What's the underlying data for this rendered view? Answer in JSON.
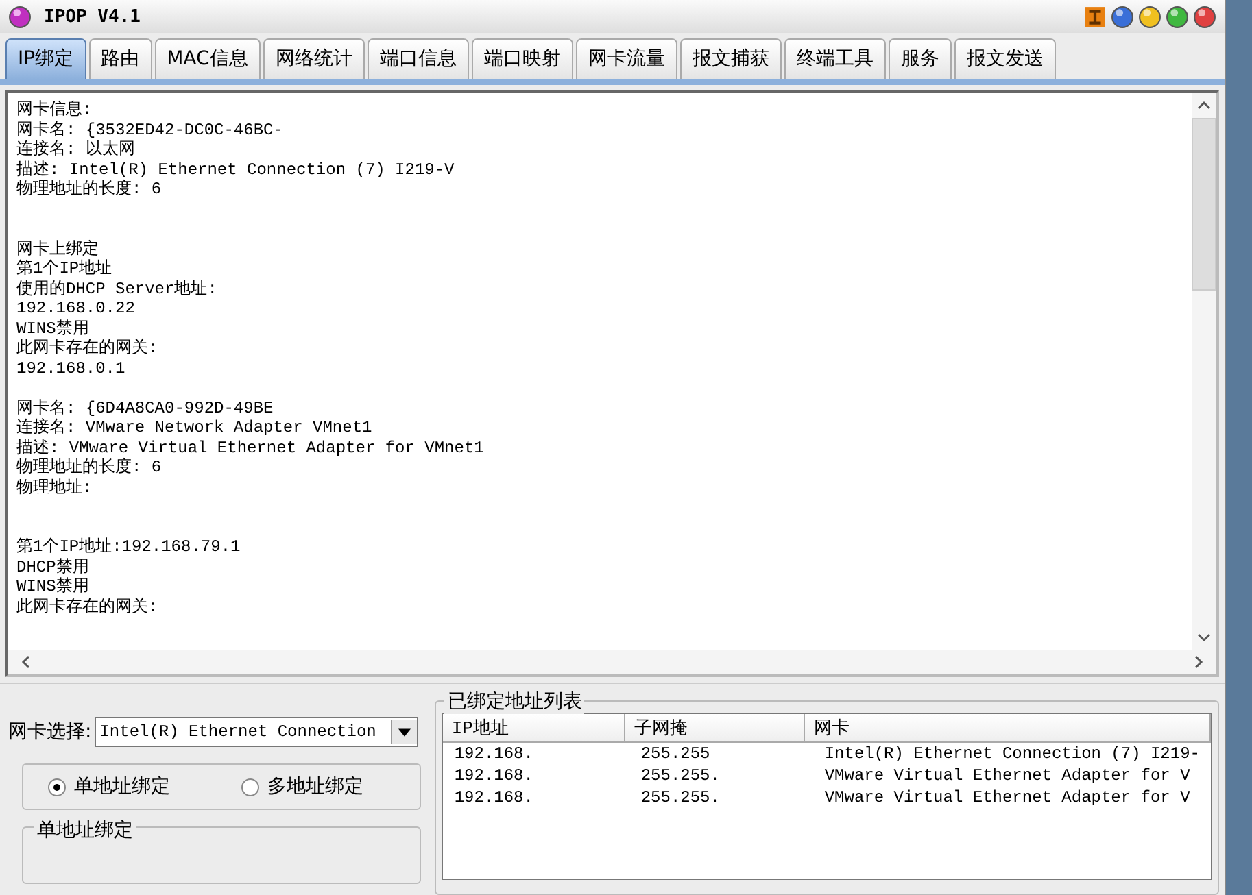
{
  "window": {
    "title": "IPOP  V4.1"
  },
  "tabs": [
    {
      "label": "IP绑定",
      "selected": true
    },
    {
      "label": "路由",
      "selected": false
    },
    {
      "label": "MAC信息",
      "selected": false
    },
    {
      "label": "网络统计",
      "selected": false
    },
    {
      "label": "端口信息",
      "selected": false
    },
    {
      "label": "端口映射",
      "selected": false
    },
    {
      "label": "网卡流量",
      "selected": false
    },
    {
      "label": "报文捕获",
      "selected": false
    },
    {
      "label": "终端工具",
      "selected": false
    },
    {
      "label": "服务",
      "selected": false
    },
    {
      "label": "报文发送",
      "selected": false
    }
  ],
  "output_lines": [
    {
      "kind": "text",
      "text": "网卡信息:"
    },
    {
      "kind": "text",
      "text": "网卡名: {3532ED42-DC0C-46BC-"
    },
    {
      "kind": "text",
      "text": "连接名: 以太网"
    },
    {
      "kind": "text",
      "text": "描述: Intel(R) Ethernet Connection (7) I219-V"
    },
    {
      "kind": "text",
      "text": "物理地址的长度: 6"
    },
    {
      "kind": "blank"
    },
    {
      "kind": "blank"
    },
    {
      "kind": "text",
      "text": "网卡上绑定"
    },
    {
      "kind": "text",
      "text": "第1个IP地址"
    },
    {
      "kind": "text",
      "text": "使用的DHCP Server地址:"
    },
    {
      "kind": "text",
      "text": "192.168.0.22"
    },
    {
      "kind": "text",
      "text": "WINS禁用"
    },
    {
      "kind": "text",
      "text": "此网卡存在的网关:"
    },
    {
      "kind": "text",
      "text": "192.168.0.1"
    },
    {
      "kind": "blank"
    },
    {
      "kind": "text",
      "text": "网卡名: {6D4A8CA0-992D-49BE"
    },
    {
      "kind": "text",
      "text": "连接名: VMware Network Adapter VMnet1"
    },
    {
      "kind": "text",
      "text": "描述: VMware Virtual Ethernet Adapter for VMnet1"
    },
    {
      "kind": "text",
      "text": "物理地址的长度: 6"
    },
    {
      "kind": "text",
      "text": "物理地址:"
    },
    {
      "kind": "blank"
    },
    {
      "kind": "blank"
    },
    {
      "kind": "text",
      "text": "第1个IP地址:192.168.79.1"
    },
    {
      "kind": "text",
      "text": "DHCP禁用"
    },
    {
      "kind": "text",
      "text": "WINS禁用"
    },
    {
      "kind": "text",
      "text": "此网卡存在的网关:"
    }
  ],
  "adapter_select": {
    "label": "网卡选择:",
    "value": "Intel(R) Ethernet Connection"
  },
  "bind_modes": [
    {
      "label": "单地址绑定",
      "selected": true
    },
    {
      "label": "多地址绑定",
      "selected": false
    }
  ],
  "single_bind_group": {
    "title": "单地址绑定"
  },
  "bound_list": {
    "title": "已绑定地址列表",
    "columns": [
      "IP地址",
      "子网掩",
      "网卡"
    ],
    "rows": [
      [
        "192.168.",
        "255.255",
        "Intel(R) Ethernet Connection (7) I219-"
      ],
      [
        "192.168.",
        "255.255.",
        "VMware Virtual Ethernet Adapter for V"
      ],
      [
        "192.168.",
        "255.255.",
        "VMware Virtual Ethernet Adapter for V"
      ]
    ]
  }
}
